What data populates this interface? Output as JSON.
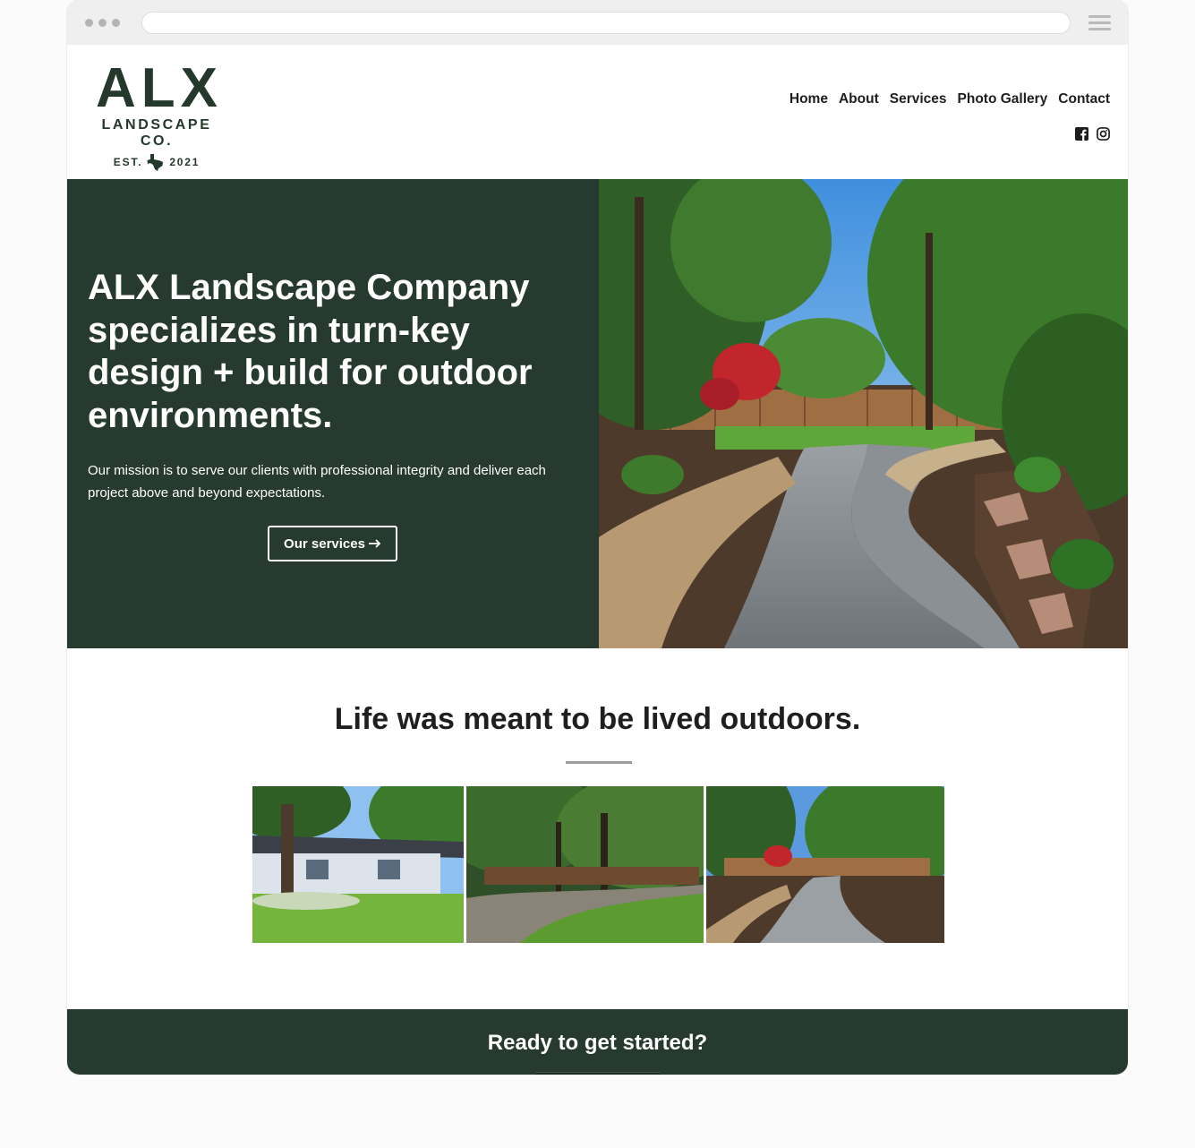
{
  "header": {
    "logo": {
      "name": "ALX",
      "subtitle": "LANDSCAPE CO.",
      "est_prefix": "EST.",
      "est_year": "2021"
    },
    "nav": [
      "Home",
      "About",
      "Services",
      "Photo Gallery",
      "Contact"
    ],
    "social": [
      "facebook-icon",
      "instagram-icon"
    ]
  },
  "hero": {
    "title": "ALX Landscape Company specializes in turn-key design + build for outdoor environments.",
    "mission": "Our mission is to serve our clients with professional integrity and deliver each project above and beyond expectations.",
    "button_label": "Our services",
    "button_icon": "arrow-right-icon"
  },
  "tagline": "Life was meant to be lived outdoors.",
  "gallery": [
    "house-lawn-photo",
    "backyard-trees-photo",
    "gravel-path-photo"
  ],
  "cta": {
    "title": "Ready to get started?"
  },
  "colors": {
    "brand_green": "#263a2f",
    "logo_green": "#24382c",
    "text_dark": "#1e1e1e"
  }
}
